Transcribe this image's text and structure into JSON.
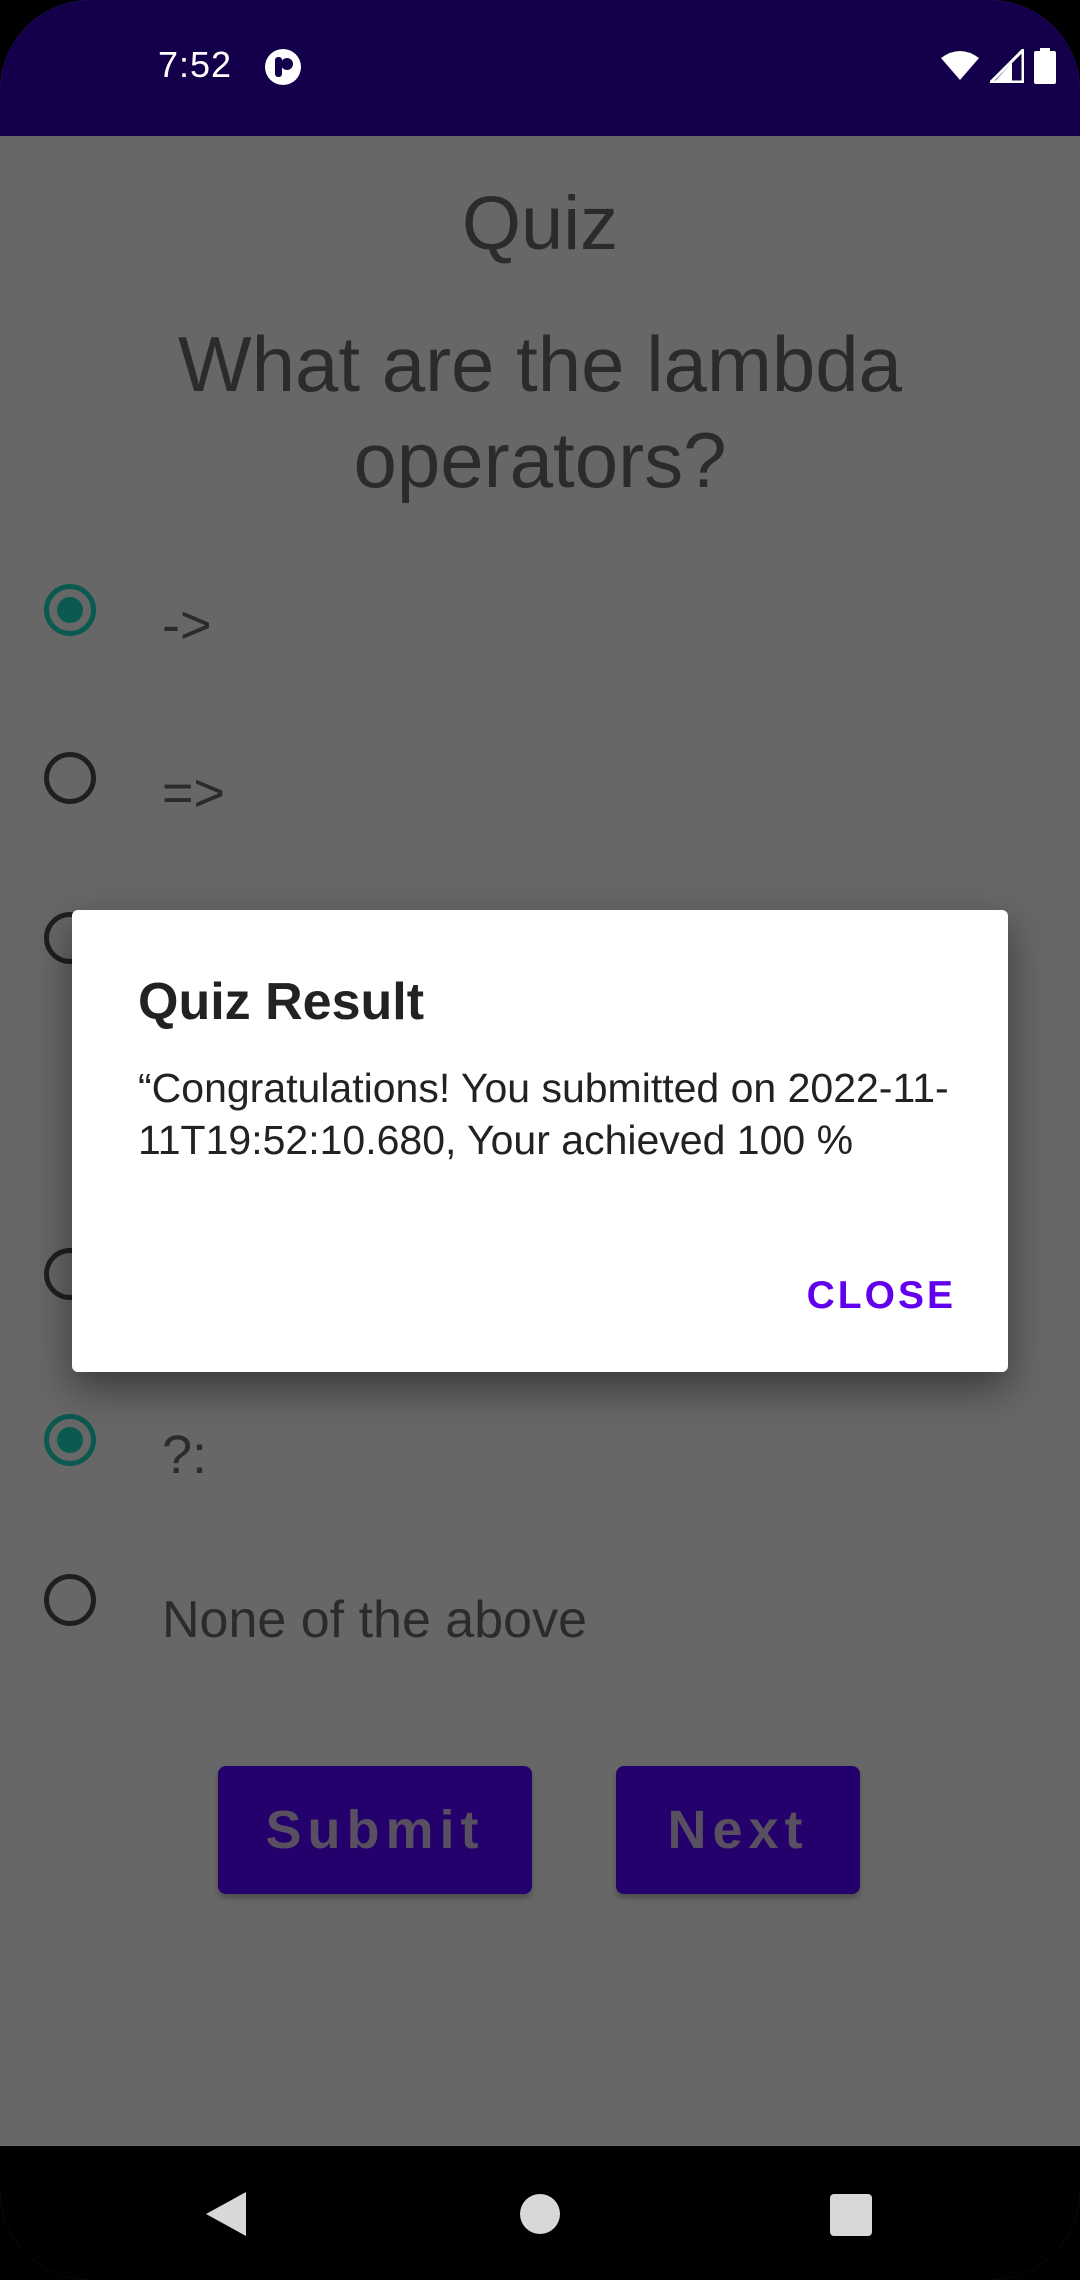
{
  "status_bar": {
    "time": "7:52",
    "icons": [
      "app-notification-icon",
      "wifi-icon",
      "signal-icon",
      "battery-icon"
    ],
    "background": "#14004a"
  },
  "app": {
    "title": "Quiz",
    "question": "What are the lambda operators?",
    "options": [
      {
        "label": "->",
        "checked": true
      },
      {
        "label": "=>",
        "checked": false
      },
      {
        "label": "",
        "checked": false
      },
      {
        "label": "",
        "checked": false
      },
      {
        "label": "?:",
        "checked": true
      },
      {
        "label": "None of the above",
        "checked": false
      }
    ],
    "submit_label": "Submit",
    "next_label": "Next",
    "accent_color": "#23006b",
    "radio_checked_color": "#0a5a50"
  },
  "dialog": {
    "title": "Quiz Result",
    "message": "“Congratulations! You submitted on 2022-11-11T19:52:10.680, Your achieved 100 %",
    "close_label": "CLOSE",
    "button_color": "#6200ee"
  },
  "nav_bar": {
    "icons": [
      "back-icon",
      "home-icon",
      "recents-icon"
    ]
  }
}
